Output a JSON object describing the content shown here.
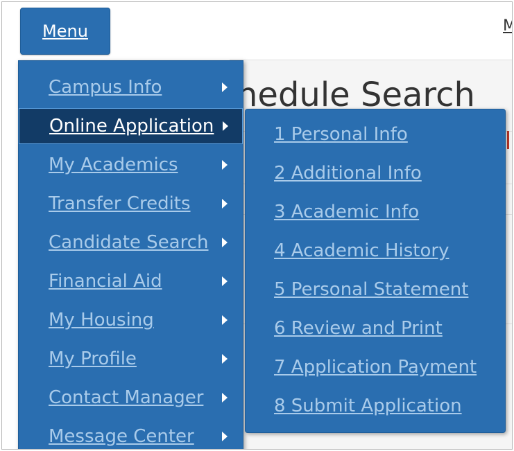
{
  "header": {
    "menu_label": "Menu",
    "right_link": "M"
  },
  "background": {
    "title": "hedule Search"
  },
  "menu": {
    "items": [
      {
        "label": "Campus Info"
      },
      {
        "label": "Online Application",
        "active": true
      },
      {
        "label": "My Academics"
      },
      {
        "label": "Transfer Credits"
      },
      {
        "label": "Candidate Search"
      },
      {
        "label": "Financial Aid"
      },
      {
        "label": "My Housing"
      },
      {
        "label": "My Profile"
      },
      {
        "label": "Contact Manager"
      },
      {
        "label": "Message Center"
      }
    ],
    "arrow_icon": "caret-right-icon"
  },
  "submenu": {
    "items": [
      {
        "label": "1 Personal Info"
      },
      {
        "label": "2 Additional Info"
      },
      {
        "label": "3 Academic Info"
      },
      {
        "label": "4 Academic History"
      },
      {
        "label": "5 Personal Statement"
      },
      {
        "label": "6 Review and Print"
      },
      {
        "label": "7 Application Payment"
      },
      {
        "label": "8 Submit Application"
      }
    ]
  },
  "colors": {
    "menu_bg": "#2a6eb0",
    "active_bg": "#123b66",
    "link_text": "#a9cbea",
    "active_text": "#ffffff"
  }
}
